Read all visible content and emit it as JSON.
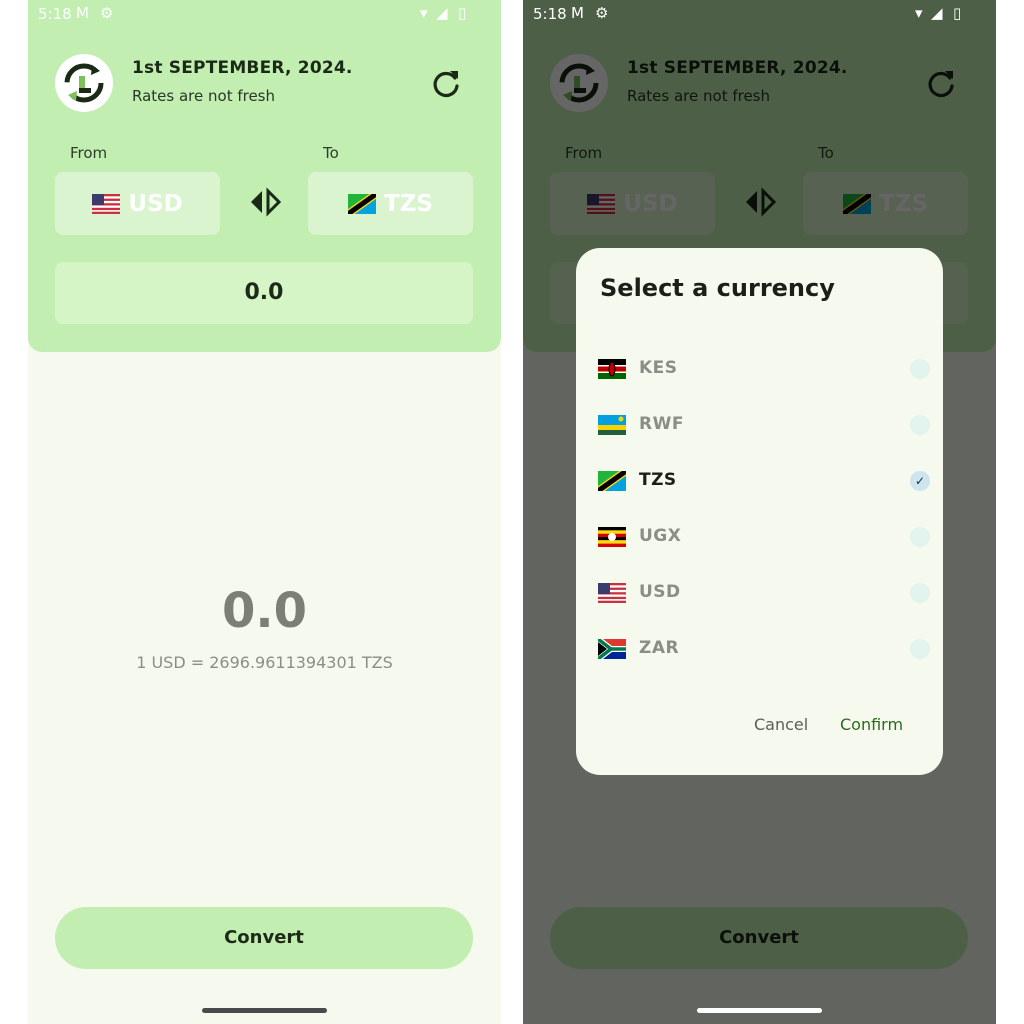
{
  "status_bar": {
    "time": "5:18"
  },
  "header": {
    "date": "1st SEPTEMBER, 2024.",
    "freshness": "Rates are not fresh",
    "from_label": "From",
    "to_label": "To",
    "from_currency": "USD",
    "to_currency": "TZS",
    "amount": "0.0"
  },
  "result": {
    "value": "0.0",
    "rate_text": "1 USD = 2696.9611394301 TZS"
  },
  "convert_label": "Convert",
  "dialog": {
    "title": "Select a currency",
    "options": [
      {
        "code": "KES",
        "flag": "kenya-flag",
        "selected": false
      },
      {
        "code": "RWF",
        "flag": "rwanda-flag",
        "selected": false
      },
      {
        "code": "TZS",
        "flag": "tanzania-flag",
        "selected": true
      },
      {
        "code": "UGX",
        "flag": "uganda-flag",
        "selected": false
      },
      {
        "code": "USD",
        "flag": "usa-flag",
        "selected": false
      },
      {
        "code": "ZAR",
        "flag": "south-africa-flag",
        "selected": false
      }
    ],
    "cancel": "Cancel",
    "confirm": "Confirm"
  },
  "colors": {
    "header_bg": "#c2eeb2",
    "page_bg": "#f6f9ee",
    "confirm_text": "#2d6a1f"
  }
}
